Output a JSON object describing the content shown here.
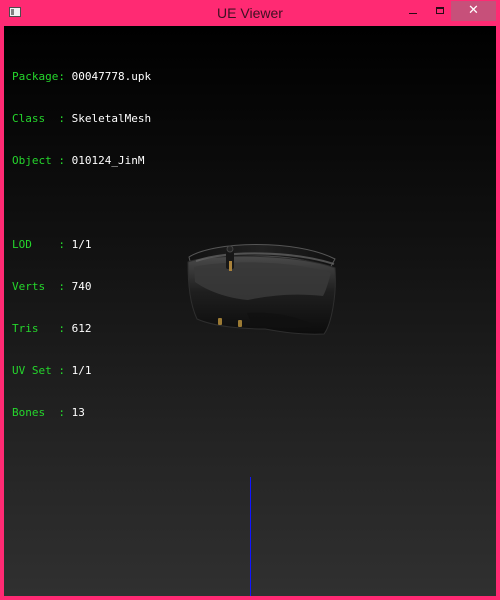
{
  "window": {
    "title": "UE Viewer",
    "minimize_symbol": "",
    "maximize_symbol": "",
    "close_symbol": "✕"
  },
  "info": {
    "package_label": "Package:",
    "package_value": "00047778.upk",
    "class_label": "Class",
    "class_value": "SkeletalMesh",
    "object_label": "Object",
    "object_value": "010124_JinM",
    "lod_label": "LOD",
    "lod_value": "1/1",
    "verts_label": "Verts",
    "verts_value": "740",
    "tris_label": "Tris",
    "tris_value": "612",
    "uv_label": "UV Set",
    "uv_value": "1/1",
    "bones_label": "Bones",
    "bones_value": "13",
    "colon": ":"
  },
  "icons": {
    "app": "app-window-icon",
    "minimize": "minimize-icon",
    "maximize": "maximize-icon",
    "close": "close-icon"
  },
  "colors": {
    "title_bar": "#ff2a73",
    "info_label": "#25d62c",
    "info_value": "#ffffff",
    "axis": "#1116ff",
    "mesh": "#2b2b2b"
  }
}
